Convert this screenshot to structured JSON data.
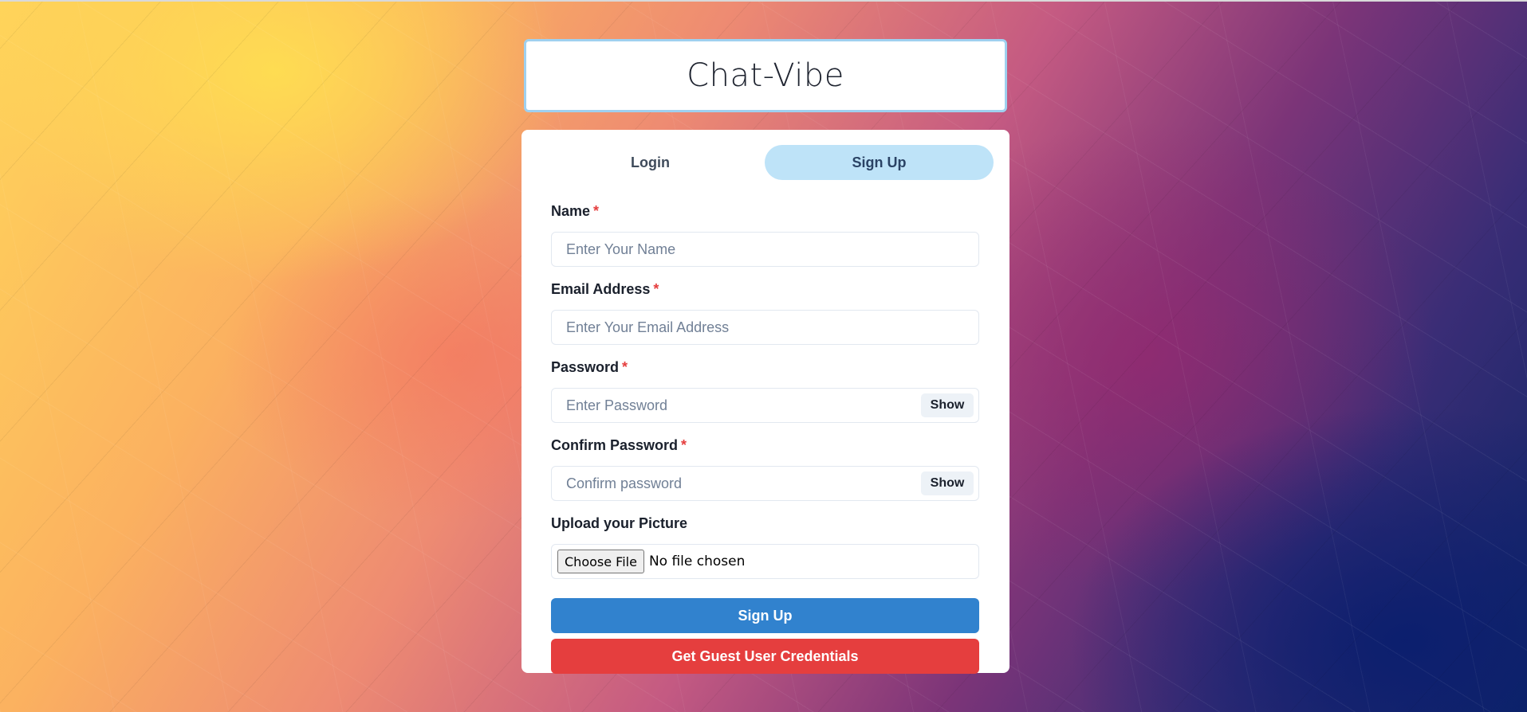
{
  "app": {
    "title": "Chat-Vibe"
  },
  "tabs": [
    {
      "label": "Login",
      "active": false
    },
    {
      "label": "Sign Up",
      "active": true
    }
  ],
  "form": {
    "name": {
      "label": "Name",
      "required_marker": "*",
      "placeholder": "Enter Your Name",
      "value": ""
    },
    "email": {
      "label": "Email Address",
      "required_marker": "*",
      "placeholder": "Enter Your Email Address",
      "value": ""
    },
    "password": {
      "label": "Password",
      "required_marker": "*",
      "placeholder": "Enter Password",
      "value": "",
      "toggle_label": "Show"
    },
    "confirm_password": {
      "label": "Confirm Password",
      "required_marker": "*",
      "placeholder": "Confirm password",
      "value": "",
      "toggle_label": "Show"
    },
    "picture": {
      "label": "Upload your Picture",
      "button_label": "Choose File",
      "status": "No file chosen"
    }
  },
  "actions": {
    "signup_label": "Sign Up",
    "guest_label": "Get Guest User Credentials"
  },
  "colors": {
    "primary": "#3182ce",
    "danger": "#e53e3e",
    "active_tab": "#bee3f8",
    "title_border": "#9fd0ef",
    "required": "#e53e3e"
  }
}
